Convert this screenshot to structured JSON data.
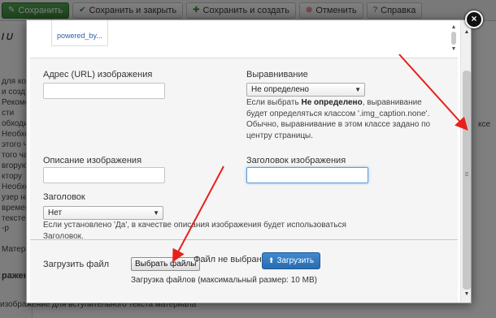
{
  "background": {
    "toolbar": [
      {
        "label": "Сохранить",
        "icon": "save-icon",
        "style": "green"
      },
      {
        "label": "Сохранить и закрыть",
        "icon": "check-icon",
        "style": "default"
      },
      {
        "label": "Сохранить и создать",
        "icon": "plus-icon",
        "style": "default"
      },
      {
        "label": "Отменить",
        "icon": "cancel-icon",
        "style": "default"
      },
      {
        "label": "Справка",
        "icon": "help-icon",
        "style": "default"
      }
    ],
    "left_fragments": [
      "для когд",
      "и созд",
      "Рекоменд",
      "сти",
      "обходимо",
      "Необход",
      "этого ч",
      "того ча",
      "вгорую",
      "ктору",
      "Необход",
      "узер на",
      "временн",
      "тексте в",
      "-р"
    ],
    "tab_fragment": "Матер",
    "heading_fragment": "ражен",
    "bottom_fragment": "изображение для вступительного текста материала",
    "right_fragment": "ксе"
  },
  "modal": {
    "close_symbol": "×",
    "thumbnail_label": "powered_by...",
    "url_label": "Адрес (URL) изображения",
    "url_value": "",
    "align_label": "Выравнивание",
    "align_value": "Не определено",
    "align_note_prefix": "Если выбрать ",
    "align_note_bold": "Не определено",
    "align_note_rest": ", выравнивание будет определяться классом '.img_caption.none'. Обычно, выравнивание в этом классе задано по центру страницы.",
    "alt_label": "Описание изображения",
    "alt_value": "",
    "title_label": "Заголовок изображения",
    "title_value": "",
    "caption_label": "Заголовок",
    "caption_value": "Нет",
    "caption_note": "Если установлено 'Да', в качестве описания изображения будет использоваться Заголовок.",
    "upload_label": "Загрузить файл",
    "choose_button": "Выбрать файлы",
    "no_file_text": "Файл не выбран",
    "upload_button": "Загрузить",
    "upload_hint": "Загрузка файлов (максимальный размер: 10 MB)"
  },
  "colors": {
    "annotation_arrow": "#e8201c",
    "primary_button": "#2a6cb0",
    "save_button": "#3b873b"
  }
}
